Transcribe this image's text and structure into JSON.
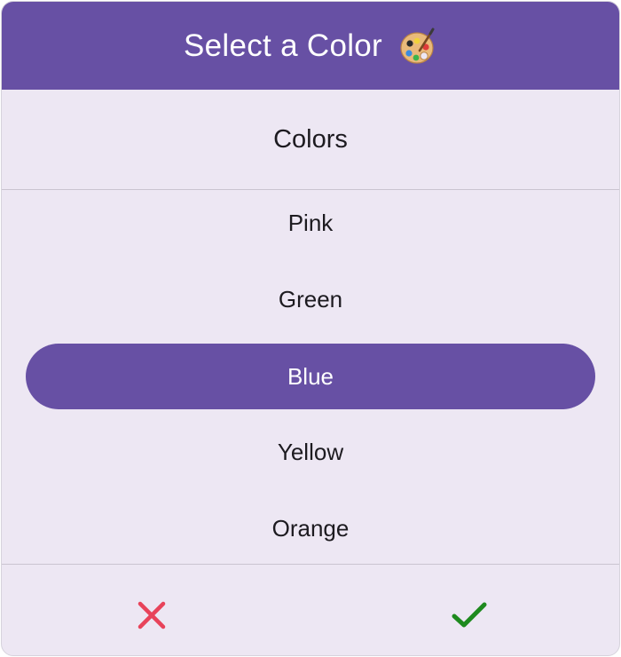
{
  "header": {
    "title": "Select a Color",
    "icon": "artist-palette-icon"
  },
  "subheader": {
    "title": "Colors"
  },
  "options": [
    {
      "label": "Pink",
      "selected": false
    },
    {
      "label": "Green",
      "selected": false
    },
    {
      "label": "Blue",
      "selected": true
    },
    {
      "label": "Yellow",
      "selected": false
    },
    {
      "label": "Orange",
      "selected": false
    }
  ],
  "footer": {
    "cancel_icon": "close-icon",
    "confirm_icon": "check-icon"
  },
  "colors": {
    "accent": "#6750a4",
    "surface": "#ede7f3",
    "cancel": "#e8435a",
    "confirm": "#1e8a1e"
  }
}
